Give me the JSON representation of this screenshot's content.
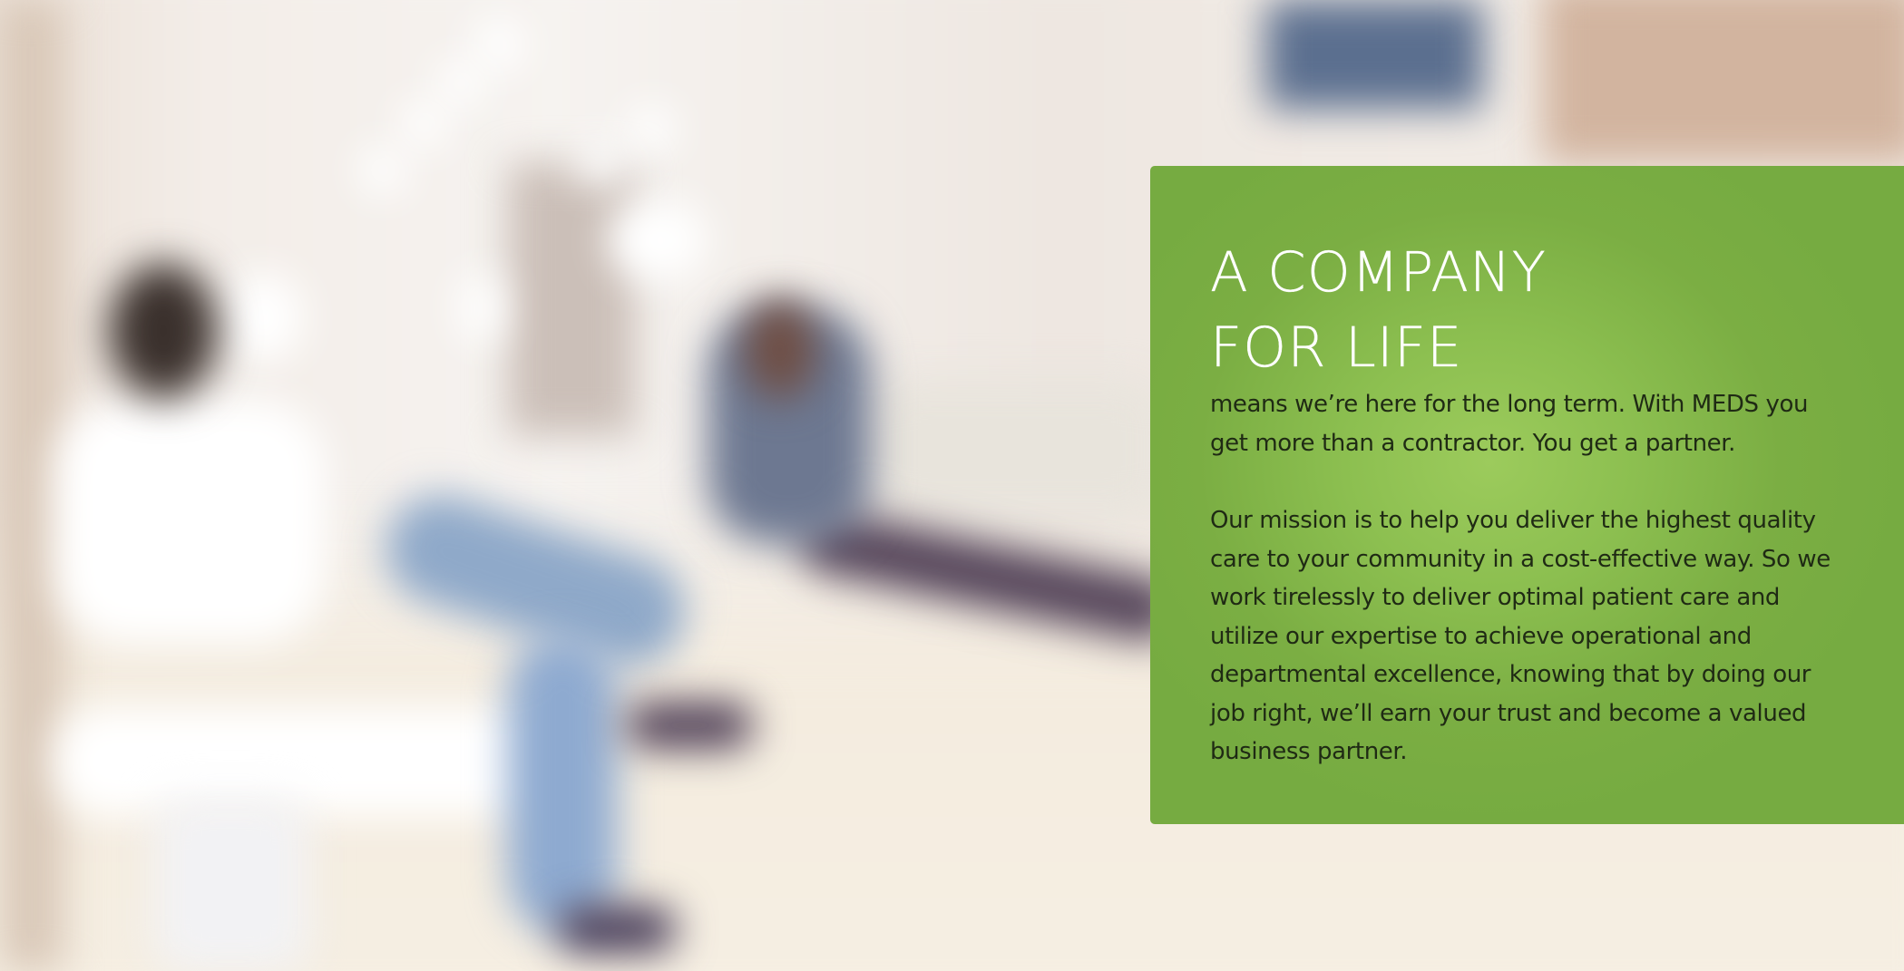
{
  "background": {
    "description_icon": "blurred-waiting-room-photo"
  },
  "card": {
    "accent_color": "#7bae43",
    "title_line1": "A COMPANY",
    "title_line2": "FOR LIFE",
    "paragraph1": "means we’re here for the long term. With MEDS you get more than a contractor. You get a partner.",
    "paragraph2": "Our mission is to help you deliver the highest quality care to your community in a cost-effective way. So we work tirelessly to deliver optimal patient care and utilize our expertise to achieve operational and departmental excellence, knowing that by doing our job right, we’ll earn your trust and become a valued business partner."
  }
}
